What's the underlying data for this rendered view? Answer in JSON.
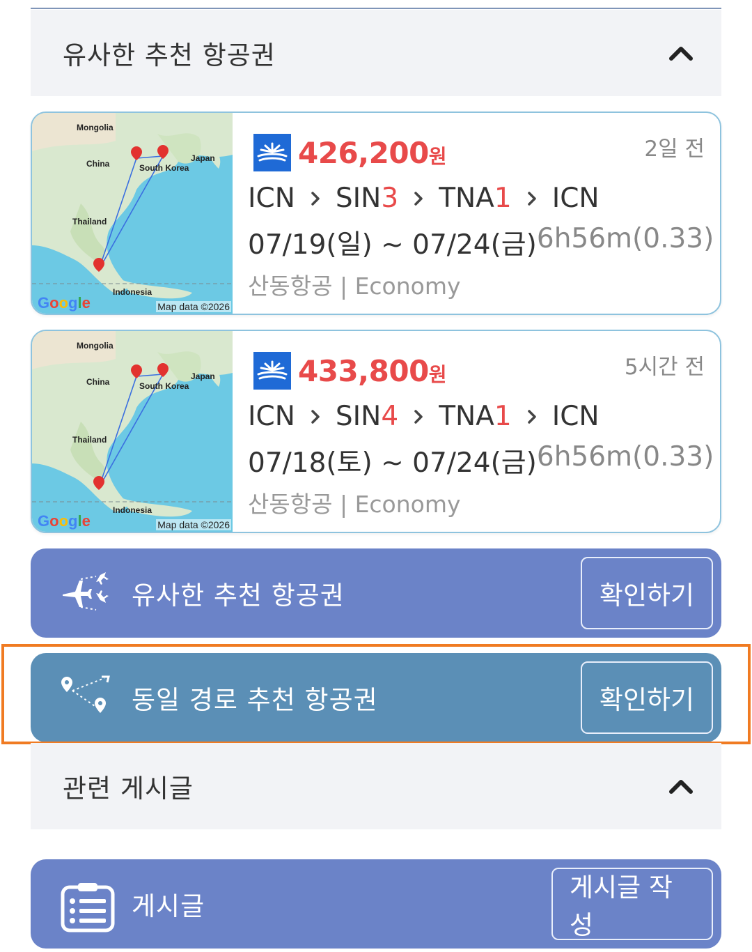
{
  "similar_section": {
    "title": "유사한 추천 항공권"
  },
  "flights": [
    {
      "price": "426,200",
      "currency": "원",
      "posted": "2일 전",
      "route": [
        {
          "code": "ICN",
          "count": ""
        },
        {
          "code": "SIN",
          "count": "3"
        },
        {
          "code": "TNA",
          "count": "1"
        },
        {
          "code": "ICN",
          "count": ""
        }
      ],
      "dates": "07/19(일) ~ 07/24(금)",
      "duration": "6h56m(0.33)",
      "airline": "산동항공",
      "cabin": "Economy",
      "map": {
        "labels": [
          "Mongolia",
          "China",
          "Japan",
          "South Korea",
          "Thailand",
          "Indonesia"
        ],
        "google": "Google",
        "copyright": "Map data ©2026"
      }
    },
    {
      "price": "433,800",
      "currency": "원",
      "posted": "5시간 전",
      "route": [
        {
          "code": "ICN",
          "count": ""
        },
        {
          "code": "SIN",
          "count": "4"
        },
        {
          "code": "TNA",
          "count": "1"
        },
        {
          "code": "ICN",
          "count": ""
        }
      ],
      "dates": "07/18(토) ~ 07/24(금)",
      "duration": "6h56m(0.33)",
      "airline": "산동항공",
      "cabin": "Economy",
      "map": {
        "labels": [
          "Mongolia",
          "China",
          "Japan",
          "South Korea",
          "Thailand",
          "Indonesia"
        ],
        "google": "Google",
        "copyright": "Map data ©2026"
      }
    }
  ],
  "actions": [
    {
      "label": "유사한 추천 항공권",
      "button": "확인하기",
      "icon": "plane-routes-icon",
      "color": "#6b83c8"
    },
    {
      "label": "동일 경로 추천 항공권",
      "button": "확인하기",
      "icon": "route-pins-icon",
      "color": "#5b8fb6"
    }
  ],
  "related_section": {
    "title": "관련 게시글"
  },
  "posts_bar": {
    "label": "게시글",
    "button": "게시글 작성",
    "icon": "clipboard-list-icon"
  },
  "colors": {
    "price_red": "#e84a4a",
    "highlight": "#f07b22",
    "card_border": "#8ec3de"
  }
}
